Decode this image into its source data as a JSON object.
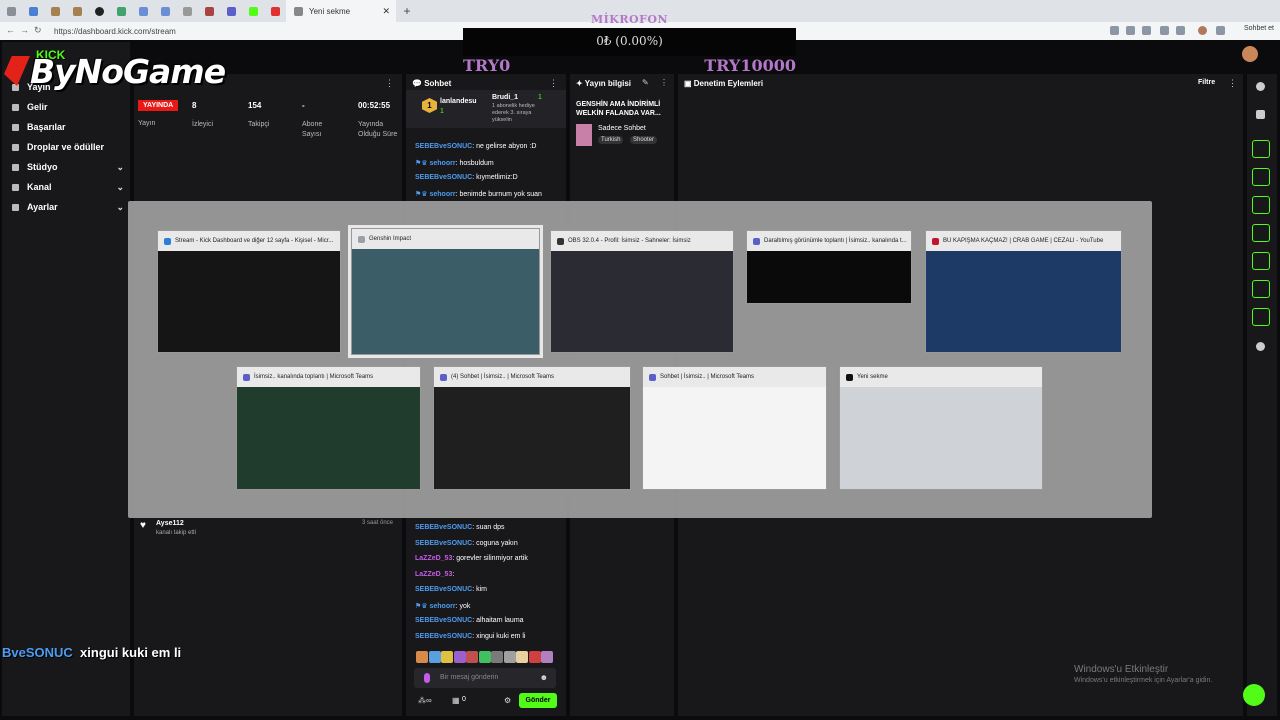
{
  "browser": {
    "active_tab": "Yeni sekme",
    "url": "https://dashboard.kick.com/stream",
    "sohbet_label": "Sohbet et"
  },
  "mic_overlay": {
    "title": "MİKROFON",
    "percent_text": "0₺ (0.00%)",
    "min_label": "TRY0",
    "max_label": "TRY10000",
    "accent": "#b478c8"
  },
  "logo": {
    "brand": "ByNoGame",
    "kick": "KICK"
  },
  "sidebar": {
    "items": [
      {
        "label": "Yayın",
        "icon": "broadcast-icon"
      },
      {
        "label": "Gelir",
        "icon": "money-icon"
      },
      {
        "label": "Başarılar",
        "icon": "trophy-icon"
      },
      {
        "label": "Droplar ve ödüller",
        "icon": "gift-icon"
      },
      {
        "label": "Stüdyo",
        "icon": "studio-icon",
        "expandable": true
      },
      {
        "label": "Kanal",
        "icon": "user-icon",
        "expandable": true
      },
      {
        "label": "Ayarlar",
        "icon": "gear-icon",
        "expandable": true
      }
    ]
  },
  "stats": {
    "live_badge": "YAYINDA",
    "stream_label": "Yayın",
    "viewers": {
      "value": "8",
      "label": "İzleyici"
    },
    "followers": {
      "value": "154",
      "label": "Takipçi"
    },
    "subs": {
      "value": "-",
      "label": "Abone Sayısı"
    },
    "uptime": {
      "value": "00:52:55",
      "label": "Yayında Olduğu Süre"
    }
  },
  "activity": {
    "user": "Ayse112",
    "action": "kanalı takip etti",
    "time": "3 saat önce"
  },
  "chat": {
    "title": "Sohbet",
    "top_user": "lanlandesu",
    "top_count": "1",
    "gift_user": "Brudi_1",
    "gift_count": "1",
    "gift_text1": "1 abonelik hediye",
    "gift_text2": "ederek 3. sıraya",
    "gift_text3": "yükselin",
    "messages_top": [
      {
        "user": "SEBEBveSONUC",
        "text": "ne gelirse abyon :D",
        "style": "u"
      },
      {
        "user": "sehoorr",
        "text": "hosbuldum",
        "style": "u",
        "badges": true
      },
      {
        "user": "SEBEBveSONUC",
        "text": "kıymetlimiz:D",
        "style": "u"
      },
      {
        "user": "sehoorr",
        "text": "benimde burnum yok suan",
        "style": "u",
        "badges": true
      }
    ],
    "messages_bottom": [
      {
        "user": "SEBEBveSONUC",
        "text": "suan dps",
        "style": "u"
      },
      {
        "user": "SEBEBveSONUC",
        "text": "coguna yakın",
        "style": "u"
      },
      {
        "user": "LaZZeD_53",
        "text": "gorevler silinmiyor artik",
        "style": "u2"
      },
      {
        "user": "LaZZeD_53",
        "text": "",
        "style": "u2"
      },
      {
        "user": "SEBEBveSONUC",
        "text": "kim",
        "style": "u"
      },
      {
        "user": "sehoorr",
        "text": "yok",
        "style": "u",
        "badges": true
      },
      {
        "user": "SEBEBveSONUC",
        "text": "alhaitam lauma",
        "style": "u"
      },
      {
        "user": "SEBEBveSONUC",
        "text": "xingui kuki em li",
        "style": "u"
      }
    ],
    "input_placeholder": "Bir mesaj gönderin",
    "points": "0",
    "send_label": "Gönder"
  },
  "stream_info": {
    "title": "Yayın bilgisi",
    "stream_title": "GENSHİN AMA İNDİRİMLİ WELKİN FALANDA VAR...",
    "category": "Sadece Sohbet",
    "tags": [
      "Turkish",
      "Shooter"
    ]
  },
  "mod_panel": {
    "title": "Denetim Eylemleri",
    "filter_label": "Filtre"
  },
  "switcher": {
    "windows_row1": [
      {
        "title": "Stream - Kick Dashboard ve diğer 12 sayfa - Kişisel - Micr...",
        "icon_color": "#2b7fd6",
        "body": "#151515"
      },
      {
        "title": "Genshin Impact",
        "icon_color": "#9aa0a8",
        "body": "#3a5d68",
        "selected": true
      },
      {
        "title": "OBS 32.0.4 - Profil: İsimsiz - Sahneler: İsimsiz",
        "icon_color": "#333333",
        "body": "#2a2b33"
      },
      {
        "title": "Daraltılmış görünümle toplantı | İsimsiz.. kanalında t...",
        "icon_color": "#5b5fc7",
        "body": "#0a0a0a"
      },
      {
        "title": "BU KAPIŞMA KAÇMAZ! | CRAB GAME | CEZALI - YouTube",
        "icon_color": "#c4122f",
        "body": "#1d3a66"
      }
    ],
    "windows_row2": [
      {
        "title": "İsimsiz.. kanalında toplantı | Microsoft Teams",
        "icon_color": "#5b5fc7",
        "body": "#203c2c"
      },
      {
        "title": "(4) Sohbet | İsimsiz.. | Microsoft Teams",
        "icon_color": "#5b5fc7",
        "body": "#1f1f1f"
      },
      {
        "title": "Sohbet | İsimsiz.. | Microsoft Teams",
        "icon_color": "#5b5fc7",
        "body": "#f4f4f4"
      },
      {
        "title": "Yeni sekme",
        "icon_color": "#111111",
        "body": "#cfd3d8"
      }
    ]
  },
  "overlay_chat": {
    "user": "BveSONUC",
    "text": "xingui kuki em li"
  },
  "windows_activation": {
    "line1": "Windows'u Etkinleştir",
    "line2": "Windows'u etkinleştirmek için Ayarlar'a gidin."
  }
}
